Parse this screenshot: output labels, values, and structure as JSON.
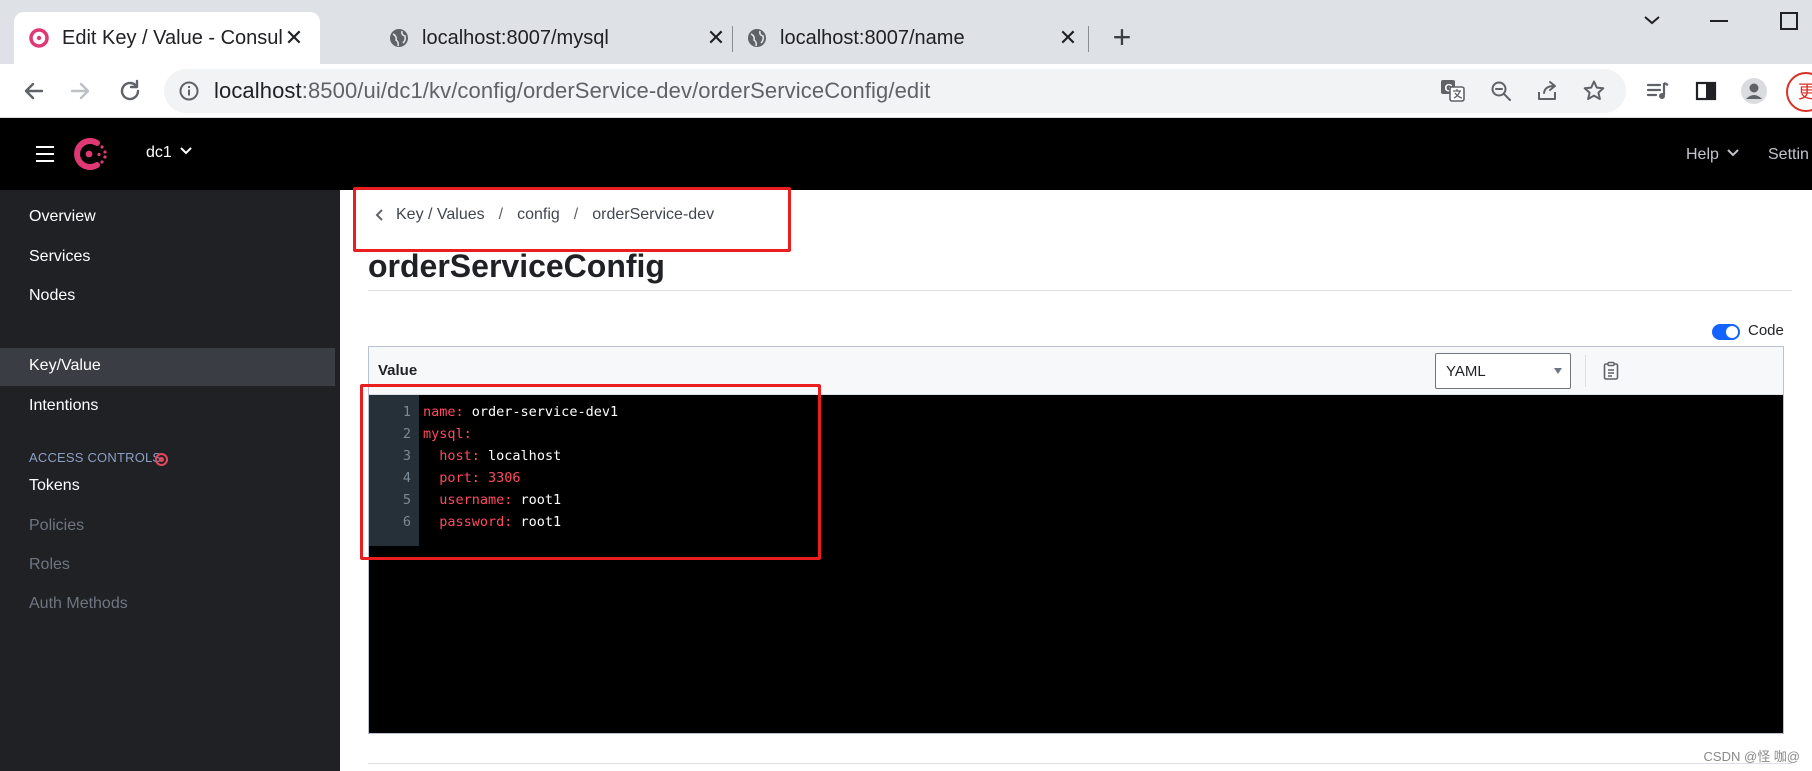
{
  "browser": {
    "tabs": [
      {
        "title": "Edit Key / Value - Consul",
        "icon": "consul-favicon",
        "active": true
      },
      {
        "title": "localhost:8007/mysql",
        "icon": "globe-icon",
        "active": false
      },
      {
        "title": "localhost:8007/name",
        "icon": "globe-icon",
        "active": false
      }
    ],
    "url": {
      "host": "localhost",
      "rest": ":8500/ui/dc1/kv/config/orderService-dev/orderServiceConfig/edit"
    },
    "profile_stub": "更"
  },
  "header": {
    "datacenter": "dc1",
    "help": "Help",
    "settings": "Settin"
  },
  "sidebar": {
    "items": [
      {
        "label": "Overview"
      },
      {
        "label": "Services"
      },
      {
        "label": "Nodes"
      },
      {
        "label": "Key/Value",
        "active": true
      },
      {
        "label": "Intentions"
      }
    ],
    "access_heading": "ACCESS CONTROLS",
    "access_items": [
      {
        "label": "Tokens",
        "enabled": true
      },
      {
        "label": "Policies",
        "enabled": false
      },
      {
        "label": "Roles",
        "enabled": false
      },
      {
        "label": "Auth Methods",
        "enabled": false
      }
    ]
  },
  "main": {
    "breadcrumb": [
      "Key / Values",
      "config",
      "orderService-dev"
    ],
    "breadcrumb_sep": "/",
    "title": "orderServiceConfig",
    "code_toggle_label": "Code",
    "code_toggle_on": true,
    "editor_label": "Value",
    "language": "YAML",
    "code_lines": [
      {
        "num": "1",
        "key": "name",
        "value": "order-service-dev1",
        "number": false
      },
      {
        "num": "2",
        "key": "mysql",
        "value": "",
        "number": false
      },
      {
        "num": "3",
        "key": "  host",
        "value": "localhost",
        "number": false
      },
      {
        "num": "4",
        "key": "  port",
        "value": "3306",
        "number": true
      },
      {
        "num": "5",
        "key": "  username",
        "value": "root1",
        "number": false
      },
      {
        "num": "6",
        "key": "  password",
        "value": "root1",
        "number": false
      }
    ]
  },
  "watermark": "CSDN @怪 咖@",
  "colors": {
    "accent": "#1563ff",
    "consul_brand": "#e03875",
    "highlight_box": "#ea1e1e",
    "yaml_key": "#ff4a5f"
  }
}
